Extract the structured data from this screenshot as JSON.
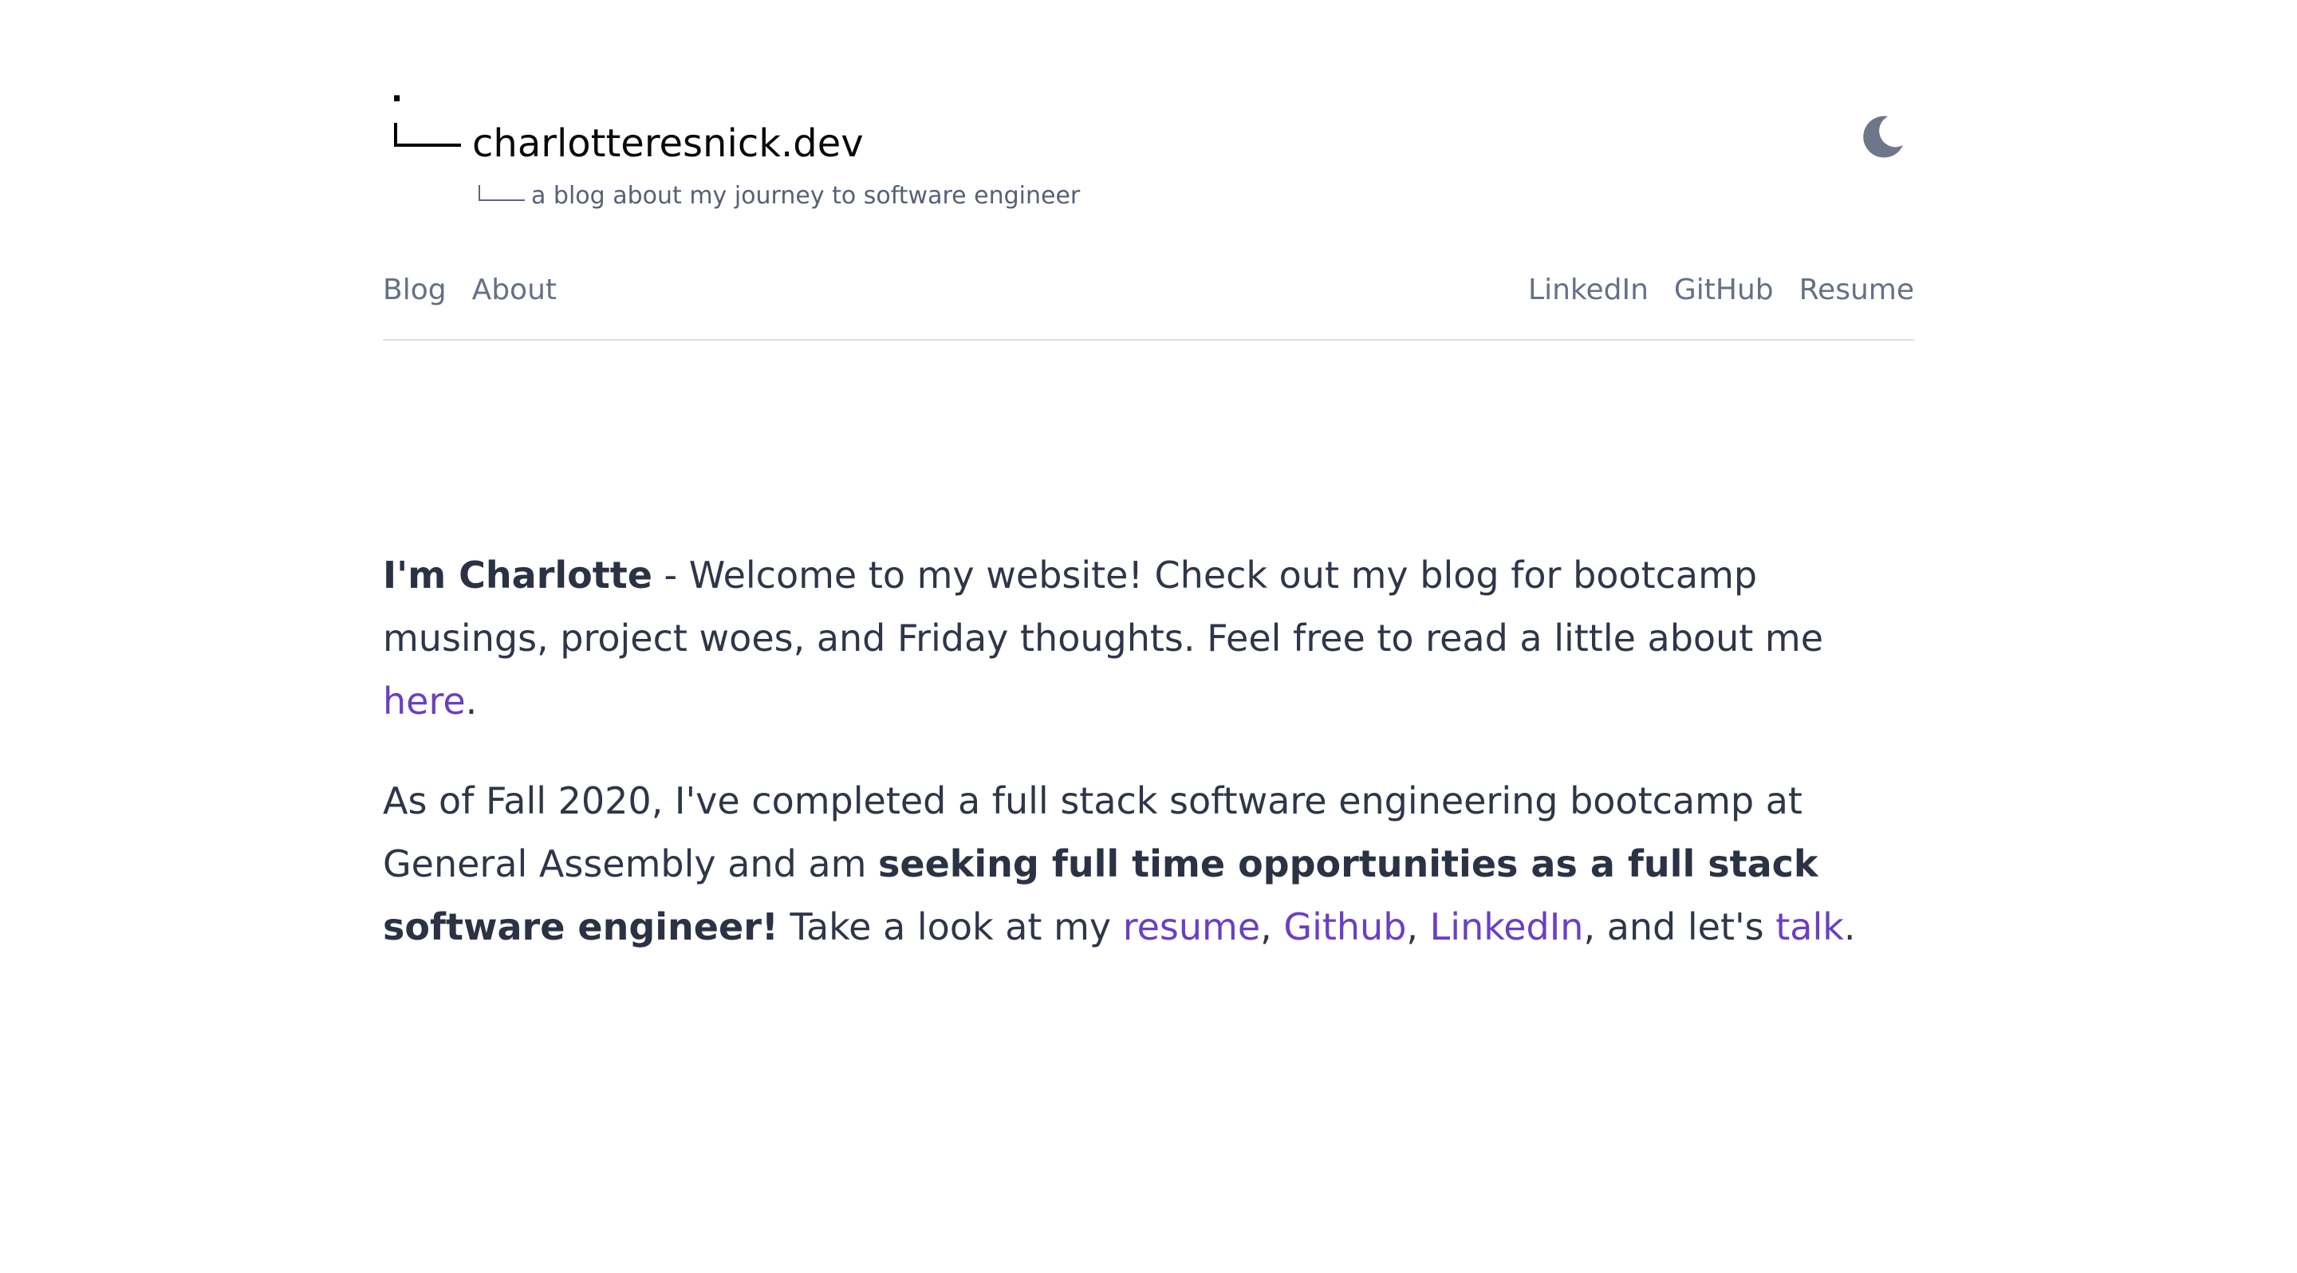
{
  "header": {
    "site_title": "charlotteresnick.dev",
    "tagline": "a blog about my journey to software engineer",
    "theme_toggle_icon": "moon-icon"
  },
  "nav": {
    "left": [
      {
        "label": "Blog"
      },
      {
        "label": "About"
      }
    ],
    "right": [
      {
        "label": "LinkedIn"
      },
      {
        "label": "GitHub"
      },
      {
        "label": "Resume"
      }
    ]
  },
  "intro": {
    "name_bold": "I'm Charlotte",
    "text1": " - Welcome to my website! Check out my blog for bootcamp musings, project woes, and Friday thoughts. Feel free to read a little about me ",
    "here_link": "here",
    "end": "."
  },
  "status": {
    "text1": "As of Fall 2020, I've completed a full stack software engineering bootcamp at General Assembly and am ",
    "bold": "seeking full time opportunities as a full stack software engineer!",
    "text2": " Take a look at my ",
    "resume_link": "resume",
    "sep1": ", ",
    "github_link": "Github",
    "sep2": ", ",
    "linkedin_link": "LinkedIn",
    "text3": ", and let's ",
    "talk_link": "talk",
    "end": "."
  },
  "colors": {
    "link": "#6b3fc4",
    "text": "#2e3648",
    "nav": "#667085",
    "icon": "#6e7789"
  }
}
